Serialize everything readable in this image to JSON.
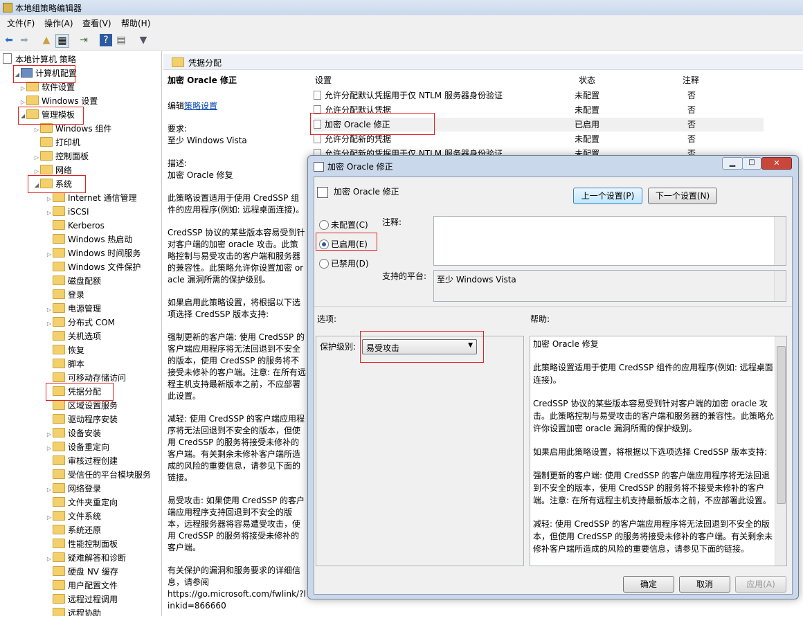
{
  "window": {
    "title": "本地组策略编辑器"
  },
  "menu": [
    "文件(F)",
    "操作(A)",
    "查看(V)",
    "帮助(H)"
  ],
  "tree": [
    {
      "label": "本地计算机 策略",
      "level": 0,
      "arrow": "",
      "icon": "doc"
    },
    {
      "label": "计算机配置",
      "level": 1,
      "arrow": "◢",
      "icon": "pc"
    },
    {
      "label": "软件设置",
      "level": 2,
      "arrow": "▷",
      "icon": "folder"
    },
    {
      "label": "Windows 设置",
      "level": 2,
      "arrow": "▷",
      "icon": "folder"
    },
    {
      "label": "管理模板",
      "level": 2,
      "arrow": "◢",
      "icon": "folder"
    },
    {
      "label": "Windows 组件",
      "level": 3,
      "arrow": "▷",
      "icon": "folder"
    },
    {
      "label": "打印机",
      "level": 3,
      "arrow": "",
      "icon": "folder"
    },
    {
      "label": "控制面板",
      "level": 3,
      "arrow": "▷",
      "icon": "folder"
    },
    {
      "label": "网络",
      "level": 3,
      "arrow": "▷",
      "icon": "folder"
    },
    {
      "label": "系统",
      "level": 3,
      "arrow": "◢",
      "icon": "folder"
    },
    {
      "label": "Internet 通信管理",
      "level": 4,
      "arrow": "▷",
      "icon": "folder"
    },
    {
      "label": "iSCSI",
      "level": 4,
      "arrow": "▷",
      "icon": "folder"
    },
    {
      "label": "Kerberos",
      "level": 4,
      "arrow": "",
      "icon": "folder"
    },
    {
      "label": "Windows 热启动",
      "level": 4,
      "arrow": "",
      "icon": "folder"
    },
    {
      "label": "Windows 时间服务",
      "level": 4,
      "arrow": "▷",
      "icon": "folder"
    },
    {
      "label": "Windows 文件保护",
      "level": 4,
      "arrow": "",
      "icon": "folder"
    },
    {
      "label": "磁盘配额",
      "level": 4,
      "arrow": "",
      "icon": "folder"
    },
    {
      "label": "登录",
      "level": 4,
      "arrow": "",
      "icon": "folder"
    },
    {
      "label": "电源管理",
      "level": 4,
      "arrow": "▷",
      "icon": "folder"
    },
    {
      "label": "分布式 COM",
      "level": 4,
      "arrow": "▷",
      "icon": "folder"
    },
    {
      "label": "关机选项",
      "level": 4,
      "arrow": "",
      "icon": "folder"
    },
    {
      "label": "恢复",
      "level": 4,
      "arrow": "",
      "icon": "folder"
    },
    {
      "label": "脚本",
      "level": 4,
      "arrow": "",
      "icon": "folder"
    },
    {
      "label": "可移动存储访问",
      "level": 4,
      "arrow": "",
      "icon": "folder"
    },
    {
      "label": "凭据分配",
      "level": 4,
      "arrow": "",
      "icon": "folder"
    },
    {
      "label": "区域设置服务",
      "level": 4,
      "arrow": "",
      "icon": "folder"
    },
    {
      "label": "驱动程序安装",
      "level": 4,
      "arrow": "",
      "icon": "folder"
    },
    {
      "label": "设备安装",
      "level": 4,
      "arrow": "▷",
      "icon": "folder"
    },
    {
      "label": "设备重定向",
      "level": 4,
      "arrow": "▷",
      "icon": "folder"
    },
    {
      "label": "审核过程创建",
      "level": 4,
      "arrow": "",
      "icon": "folder"
    },
    {
      "label": "受信任的平台模块服务",
      "level": 4,
      "arrow": "",
      "icon": "folder"
    },
    {
      "label": "网络登录",
      "level": 4,
      "arrow": "▷",
      "icon": "folder"
    },
    {
      "label": "文件夹重定向",
      "level": 4,
      "arrow": "",
      "icon": "folder"
    },
    {
      "label": "文件系统",
      "level": 4,
      "arrow": "▷",
      "icon": "folder"
    },
    {
      "label": "系统还原",
      "level": 4,
      "arrow": "",
      "icon": "folder"
    },
    {
      "label": "性能控制面板",
      "level": 4,
      "arrow": "",
      "icon": "folder"
    },
    {
      "label": "疑难解答和诊断",
      "level": 4,
      "arrow": "▷",
      "icon": "folder"
    },
    {
      "label": "硬盘 NV 缓存",
      "level": 4,
      "arrow": "",
      "icon": "folder"
    },
    {
      "label": "用户配置文件",
      "level": 4,
      "arrow": "",
      "icon": "folder"
    },
    {
      "label": "远程过程调用",
      "level": 4,
      "arrow": "",
      "icon": "folder"
    },
    {
      "label": "远程协助",
      "level": 4,
      "arrow": "",
      "icon": "folder"
    }
  ],
  "middle": {
    "header": "凭据分配",
    "title": "加密 Oracle 修正",
    "edit_prefix": "编辑",
    "edit_link": "策略设置",
    "paragraphs": [
      "要求:\n至少 Windows Vista",
      "描述:\n加密 Oracle 修复",
      "此策略设置适用于使用 CredSSP 组件的应用程序(例如: 远程桌面连接)。",
      "CredSSP 协议的某些版本容易受到针对客户端的加密 oracle 攻击。此策略控制与易受攻击的客户端和服务器的兼容性。此策略允许你设置加密 oracle 漏洞所需的保护级别。",
      "如果启用此策略设置，将根据以下选项选择 CredSSP 版本支持:",
      "强制更新的客户端: 使用 CredSSP 的客户端应用程序将无法回退到不安全的版本，使用 CredSSP 的服务将不接受未修补的客户端。注意: 在所有远程主机支持最新版本之前，不应部署此设置。",
      "减轻: 使用 CredSSP 的客户端应用程序将无法回退到不安全的版本，但使用 CredSSP 的服务将接受未修补的客户端。有关剩余未修补客户端所造成的风险的重要信息，请参见下面的链接。",
      "易受攻击: 如果使用 CredSSP 的客户端应用程序支持回退到不安全的版本，远程服务器将容易遭受攻击，使用 CredSSP 的服务将接受未修补的客户端。",
      "有关保护的漏洞和服务要求的详细信息，请参阅\nhttps://go.microsoft.com/fwlink/?linkid=866660"
    ]
  },
  "list": {
    "headers": [
      "设置",
      "状态",
      "注释"
    ],
    "rows": [
      {
        "name": "允许分配默认凭据用于仅 NTLM 服务器身份验证",
        "state": "未配置",
        "note": "否"
      },
      {
        "name": "允许分配默认凭据",
        "state": "未配置",
        "note": "否"
      },
      {
        "name": "加密 Oracle 修正",
        "state": "已启用",
        "note": "否"
      },
      {
        "name": "允许分配新的凭据",
        "state": "未配置",
        "note": "否"
      },
      {
        "name": "允许分配新的凭据用于仅 NTLM 服务器身份验证",
        "state": "未配置",
        "note": "否"
      }
    ]
  },
  "dialog": {
    "title": "加密 Oracle 修正",
    "header_label": "加密 Oracle 修正",
    "prev_button": "上一个设置(P)",
    "next_button": "下一个设置(N)",
    "radio_not_configured": "未配置(C)",
    "radio_enabled": "已启用(E)",
    "radio_disabled": "已禁用(D)",
    "comment_label": "注释:",
    "platform_label": "支持的平台:",
    "platform_value": "至少 Windows Vista",
    "options_label": "选项:",
    "help_label": "帮助:",
    "protection_label": "保护级别:",
    "protection_value": "易受攻击",
    "help_paragraphs": [
      "加密 Oracle 修复",
      "此策略设置适用于使用 CredSSP 组件的应用程序(例如: 远程桌面连接)。",
      "CredSSP 协议的某些版本容易受到针对客户端的加密 oracle 攻击。此策略控制与易受攻击的客户端和服务器的兼容性。此策略允许你设置加密 oracle 漏洞所需的保护级别。",
      "如果启用此策略设置，将根据以下选项选择 CredSSP 版本支持:",
      "强制更新的客户端: 使用 CredSSP 的客户端应用程序将无法回退到不安全的版本，使用 CredSSP 的服务将不接受未修补的客户端。注意: 在所有远程主机支持最新版本之前，不应部署此设置。",
      "减轻: 使用 CredSSP 的客户端应用程序将无法回退到不安全的版本，但使用 CredSSP 的服务将接受未修补的客户端。有关剩余未修补客户端所造成的风险的重要信息，请参见下面的链接。"
    ],
    "ok_button": "确定",
    "cancel_button": "取消",
    "apply_button": "应用(A)"
  }
}
